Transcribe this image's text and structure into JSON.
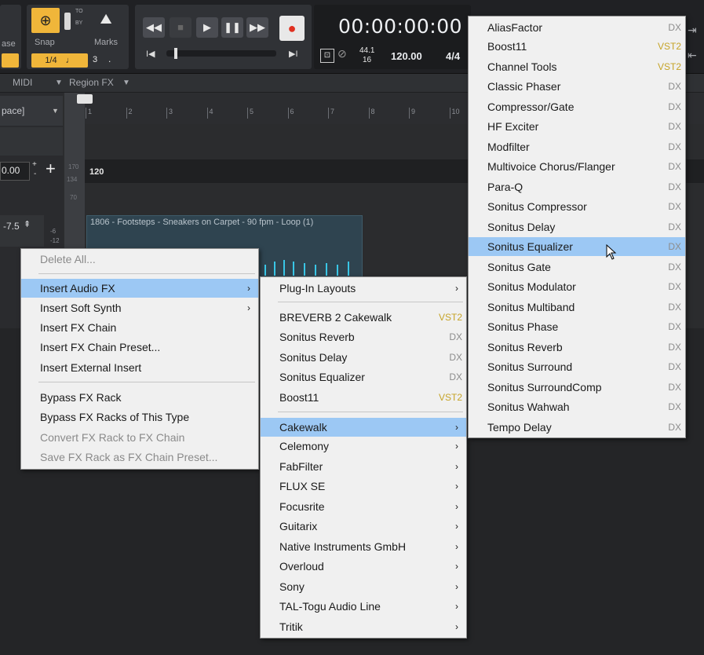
{
  "toolbar": {
    "snap_label": "Snap",
    "marks_label": "Marks",
    "snap_value": "1/4",
    "note_glyph": "♩",
    "snap_count": "3",
    "snap_dot": ".",
    "to_label": "TO",
    "by_label": "BY",
    "time": "00:00:00:00",
    "sample_rate_top": "44.1",
    "sample_rate_bottom": "16",
    "tempo": "120.00",
    "meter": "4/4",
    "left_label": "ase"
  },
  "menubar": {
    "midi": "MIDI",
    "region_fx": "Region FX",
    "workspace": "pace]"
  },
  "ruler": {
    "ticks": [
      "1",
      "2",
      "3",
      "4",
      "5",
      "6",
      "7",
      "8",
      "9",
      "10"
    ]
  },
  "track": {
    "value_top": "0.00",
    "value_gain": "-7.5",
    "tempo_marker": "120",
    "scale": [
      "170",
      "134",
      "70"
    ],
    "meter_left": [
      "-6",
      "-12"
    ]
  },
  "clip": {
    "title": "1806 - Footsteps - Sneakers on Carpet - 90 fpm - Loop (1)"
  },
  "menu1": {
    "items": [
      {
        "label": "Delete All...",
        "disabled": true
      },
      {
        "label": "Insert Audio FX",
        "arrow": "›",
        "highlighted": true
      },
      {
        "label": "Insert Soft Synth",
        "arrow": "›"
      },
      {
        "label": "Insert FX Chain"
      },
      {
        "label": "Insert FX Chain Preset..."
      },
      {
        "label": "Insert External Insert"
      },
      {
        "label": "Bypass FX Rack"
      },
      {
        "label": "Bypass FX Racks of This Type"
      },
      {
        "label": "Convert FX Rack to FX Chain",
        "disabled": true
      },
      {
        "label": "Save FX Rack as FX Chain Preset...",
        "disabled": true
      }
    ]
  },
  "menu2": {
    "items": [
      {
        "label": "Plug-In Layouts",
        "arrow": "›"
      },
      {
        "label": "BREVERB 2 Cakewalk",
        "tag": "VST2"
      },
      {
        "label": "Sonitus Reverb",
        "tag": "DX"
      },
      {
        "label": "Sonitus Delay",
        "tag": "DX"
      },
      {
        "label": "Sonitus Equalizer",
        "tag": "DX"
      },
      {
        "label": "Boost11",
        "tag": "VST2"
      },
      {
        "label": "Cakewalk",
        "arrow": "›",
        "highlighted": true
      },
      {
        "label": "Celemony",
        "arrow": "›"
      },
      {
        "label": "FabFilter",
        "arrow": "›"
      },
      {
        "label": "FLUX SE",
        "arrow": "›"
      },
      {
        "label": "Focusrite",
        "arrow": "›"
      },
      {
        "label": "Guitarix",
        "arrow": "›"
      },
      {
        "label": "Native Instruments GmbH",
        "arrow": "›"
      },
      {
        "label": "Overloud",
        "arrow": "›"
      },
      {
        "label": "Sony",
        "arrow": "›"
      },
      {
        "label": "TAL-Togu Audio Line",
        "arrow": "›"
      },
      {
        "label": "Tritik",
        "arrow": "›"
      }
    ]
  },
  "menu3": {
    "items": [
      {
        "label": "AliasFactor",
        "tag": "DX"
      },
      {
        "label": "Boost11",
        "tag": "VST2"
      },
      {
        "label": "Channel Tools",
        "tag": "VST2"
      },
      {
        "label": "Classic Phaser",
        "tag": "DX"
      },
      {
        "label": "Compressor/Gate",
        "tag": "DX"
      },
      {
        "label": "HF Exciter",
        "tag": "DX"
      },
      {
        "label": "Modfilter",
        "tag": "DX"
      },
      {
        "label": "Multivoice Chorus/Flanger",
        "tag": "DX"
      },
      {
        "label": "Para-Q",
        "tag": "DX"
      },
      {
        "label": "Sonitus Compressor",
        "tag": "DX"
      },
      {
        "label": "Sonitus Delay",
        "tag": "DX"
      },
      {
        "label": "Sonitus Equalizer",
        "tag": "DX",
        "highlighted": true
      },
      {
        "label": "Sonitus Gate",
        "tag": "DX"
      },
      {
        "label": "Sonitus Modulator",
        "tag": "DX"
      },
      {
        "label": "Sonitus Multiband",
        "tag": "DX"
      },
      {
        "label": "Sonitus Phase",
        "tag": "DX"
      },
      {
        "label": "Sonitus Reverb",
        "tag": "DX"
      },
      {
        "label": "Sonitus Surround",
        "tag": "DX"
      },
      {
        "label": "Sonitus SurroundComp",
        "tag": "DX"
      },
      {
        "label": "Sonitus Wahwah",
        "tag": "DX"
      },
      {
        "label": "Tempo Delay",
        "tag": "DX"
      }
    ]
  }
}
